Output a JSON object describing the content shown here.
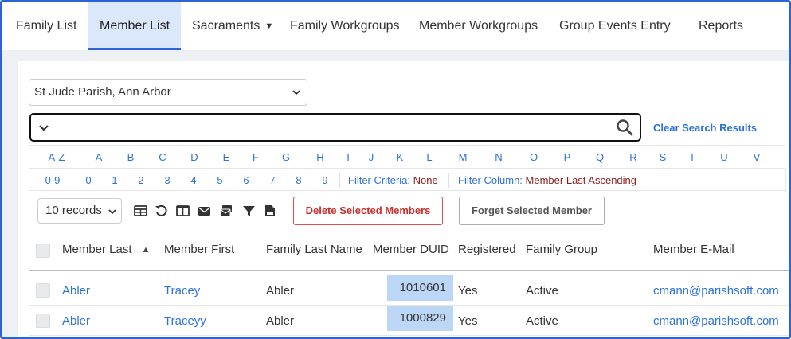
{
  "nav": {
    "tabs": [
      {
        "label": "Family List"
      },
      {
        "label": "Member List"
      },
      {
        "label": "Sacraments"
      },
      {
        "label": "Family Workgroups"
      },
      {
        "label": "Member Workgroups"
      },
      {
        "label": "Group Events Entry"
      },
      {
        "label": "Reports"
      }
    ],
    "active": "Member List"
  },
  "parish_select": {
    "value": "St Jude Parish, Ann Arbor"
  },
  "search": {
    "value": "",
    "placeholder": ""
  },
  "clear_search_label": "Clear Search Results",
  "alpha": {
    "row1": [
      "A-Z",
      "A",
      "B",
      "C",
      "D",
      "E",
      "F",
      "G",
      "H",
      "I",
      "J",
      "K",
      "L",
      "M",
      "N",
      "O",
      "P",
      "Q",
      "R",
      "S",
      "T",
      "U",
      "V"
    ],
    "row2": [
      "0-9",
      "0",
      "1",
      "2",
      "3",
      "4",
      "5",
      "6",
      "7",
      "8",
      "9"
    ]
  },
  "filter": {
    "criteria_label": "Filter Criteria:",
    "criteria_value": "None",
    "column_label": "Filter Column:",
    "column_value": "Member Last Ascending"
  },
  "records_select": {
    "value": "10 records"
  },
  "buttons": {
    "delete": "Delete Selected Members",
    "forget": "Forget Selected Member"
  },
  "table": {
    "headers": [
      "Member Last",
      "Member First",
      "Family Last Name",
      "Member DUID",
      "Registered",
      "Family Group",
      "Member E-Mail"
    ],
    "rows": [
      [
        "Abler",
        "Tracey",
        "Abler",
        "1010601",
        "Yes",
        "Active",
        "cmann@parishsoft.com"
      ],
      [
        "Abler",
        "Traceyy",
        "Abler",
        "1000829",
        "Yes",
        "Active",
        "cmann@parishsoft.com"
      ]
    ]
  },
  "colors": {
    "accent": "#2b63d8",
    "link": "#2b73d9",
    "danger": "#c9302c",
    "highlight": "#bcd6f6"
  }
}
